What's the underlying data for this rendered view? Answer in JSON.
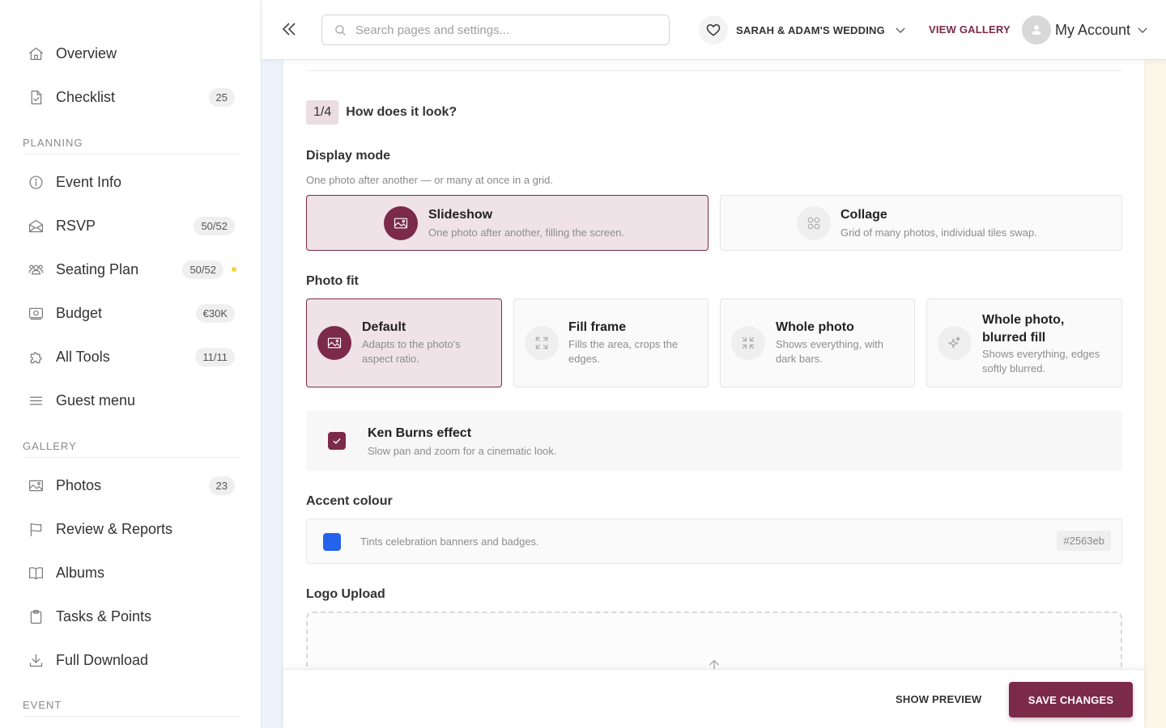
{
  "sidebar": {
    "items": [
      {
        "label": "Overview",
        "icon": "home-icon"
      },
      {
        "label": "Checklist",
        "icon": "checklist-icon",
        "badge": "25"
      }
    ],
    "sections": [
      {
        "title": "PLANNING",
        "items": [
          {
            "label": "Event Info",
            "icon": "info-icon"
          },
          {
            "label": "RSVP",
            "icon": "envelope-icon",
            "badge": "50/52"
          },
          {
            "label": "Seating Plan",
            "icon": "people-icon",
            "badge": "50/52",
            "dot_color": "#f2d72a"
          },
          {
            "label": "Budget",
            "icon": "money-icon",
            "badge": "€30K"
          },
          {
            "label": "All Tools",
            "icon": "puzzle-icon",
            "badge": "11/11"
          },
          {
            "label": "Guest menu",
            "icon": "menu-icon"
          }
        ]
      },
      {
        "title": "GALLERY",
        "items": [
          {
            "label": "Photos",
            "icon": "image-icon",
            "badge": "23"
          },
          {
            "label": "Review & Reports",
            "icon": "flag-icon"
          },
          {
            "label": "Albums",
            "icon": "book-icon"
          },
          {
            "label": "Tasks & Points",
            "icon": "clipboard-icon"
          },
          {
            "label": "Full Download",
            "icon": "download-icon"
          }
        ]
      },
      {
        "title": "EVENT",
        "items": []
      }
    ]
  },
  "topbar": {
    "search_placeholder": "Search pages and settings...",
    "event_name": "SARAH & ADAM'S WEDDING",
    "view_gallery": "VIEW GALLERY",
    "account_label": "My Account"
  },
  "content": {
    "step_badge": "1/4",
    "step_title": "How does it look?",
    "display_mode": {
      "label": "Display mode",
      "help": "One photo after another — or many at once in a grid.",
      "options": [
        {
          "title": "Slideshow",
          "desc": "One photo after another, filling the screen.",
          "selected": true,
          "icon": "image-icon"
        },
        {
          "title": "Collage",
          "desc": "Grid of many photos, individual tiles swap.",
          "selected": false,
          "icon": "grid-icon"
        }
      ]
    },
    "photo_fit": {
      "label": "Photo fit",
      "options": [
        {
          "title": "Default",
          "desc": "Adapts to the photo's aspect ratio.",
          "selected": true,
          "icon": "image-icon"
        },
        {
          "title": "Fill frame",
          "desc": "Fills the area, crops the edges.",
          "selected": false,
          "icon": "expand-icon"
        },
        {
          "title": "Whole photo",
          "desc": "Shows everything, with dark bars.",
          "selected": false,
          "icon": "shrink-icon"
        },
        {
          "title": "Whole photo, blurred fill",
          "desc": "Shows everything, edges softly blurred.",
          "selected": false,
          "icon": "sparkle-icon"
        }
      ]
    },
    "ken_burns": {
      "title": "Ken Burns effect",
      "desc": "Slow pan and zoom for a cinematic look.",
      "checked": true
    },
    "accent": {
      "label": "Accent colour",
      "desc": "Tints celebration banners and badges.",
      "hex": "#2563eb",
      "color": "#2563eb"
    },
    "logo_upload": {
      "label": "Logo Upload"
    }
  },
  "footer": {
    "show_preview": "SHOW PREVIEW",
    "save_changes": "SAVE CHANGES"
  },
  "colors": {
    "brand": "#7b2a4a",
    "brand_light": "#efe3e7"
  }
}
